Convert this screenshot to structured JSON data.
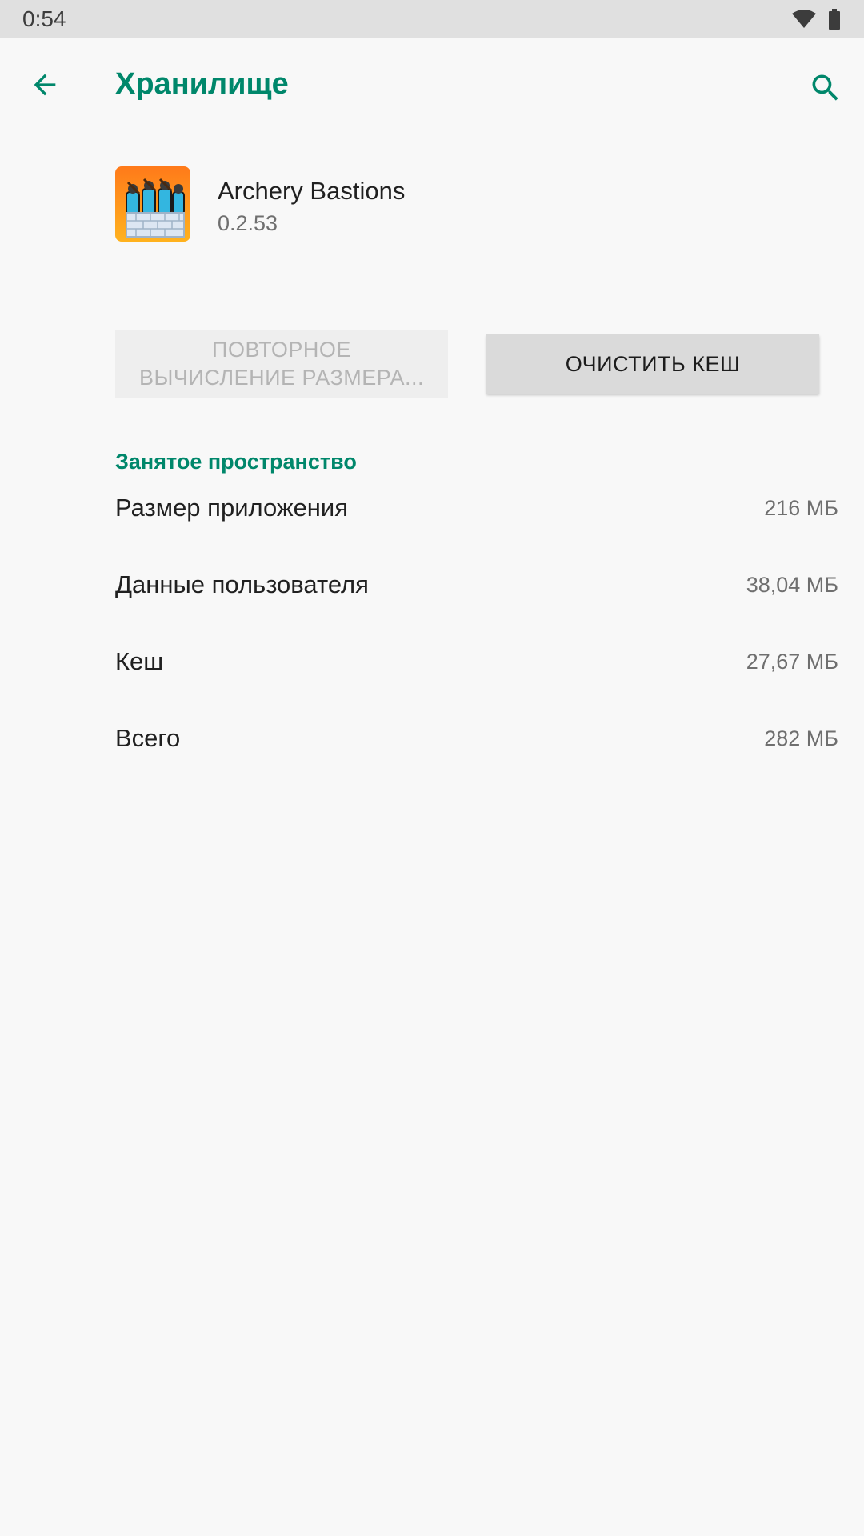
{
  "status_bar": {
    "time": "0:54",
    "icons": [
      "wifi-icon",
      "battery-icon"
    ]
  },
  "toolbar": {
    "title": "Хранилище",
    "back_icon": "arrow-back-icon",
    "search_icon": "search-icon"
  },
  "app": {
    "name": "Archery Bastions",
    "version": "0.2.53",
    "icon": "app-icon-archery-bastions"
  },
  "buttons": {
    "recalc_label": "ПОВТОРНОЕ ВЫЧИСЛЕНИЕ РАЗМЕРА...",
    "clear_cache_label": "ОЧИСТИТЬ КЕШ"
  },
  "storage": {
    "section_title": "Занятое пространство",
    "rows": [
      {
        "label": "Размер приложения",
        "value": "216 МБ"
      },
      {
        "label": "Данные пользователя",
        "value": "38,04 МБ"
      },
      {
        "label": "Кеш",
        "value": "27,67 МБ"
      },
      {
        "label": "Всего",
        "value": "282 МБ"
      }
    ]
  },
  "colors": {
    "accent": "#00876b",
    "status_bar": "#e0e0e0",
    "background": "#f8f8f8"
  }
}
